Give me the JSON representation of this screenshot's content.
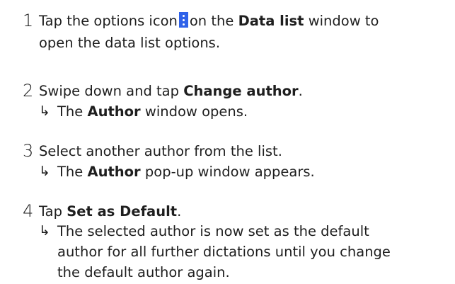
{
  "steps": [
    {
      "number": "1",
      "line1_before": "Tap the options icon",
      "line1_middle": "on the",
      "line1_bold": "Data list",
      "line1_after": "window to",
      "line2": "open the data list options.",
      "icon": "vertical-dots-options-icon"
    },
    {
      "number": "2",
      "text_before": "Swipe down and tap",
      "text_bold": "Change author",
      "text_after": ".",
      "result_arrow": "↳",
      "result_before": "The",
      "result_bold": "Author",
      "result_after": "window opens."
    },
    {
      "number": "3",
      "text": "Select another author from the list.",
      "result_arrow": "↳",
      "result_before": "The",
      "result_bold": "Author",
      "result_after": "pop-up window appears."
    },
    {
      "number": "4",
      "text_before": "Tap",
      "text_bold": "Set as Default",
      "text_after": ".",
      "result_arrow": "↳",
      "result_line1": "The selected author is now set as the default",
      "result_line2": "author for all further dictations until you change",
      "result_line3": "the default author again."
    }
  ],
  "colors": {
    "text": "#1e1e1e",
    "icon_background": "#2f62e9",
    "icon_dots": "#ffffff"
  }
}
